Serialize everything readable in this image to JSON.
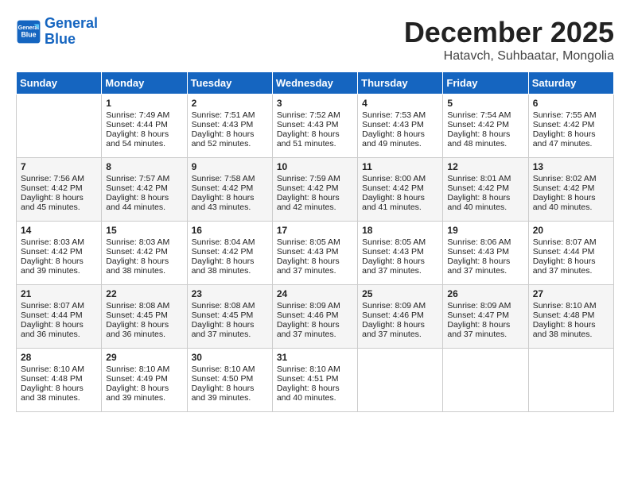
{
  "header": {
    "logo_line1": "General",
    "logo_line2": "Blue",
    "month": "December 2025",
    "location": "Hatavch, Suhbaatar, Mongolia"
  },
  "weekdays": [
    "Sunday",
    "Monday",
    "Tuesday",
    "Wednesday",
    "Thursday",
    "Friday",
    "Saturday"
  ],
  "weeks": [
    [
      {
        "day": "",
        "info": ""
      },
      {
        "day": "1",
        "info": "Sunrise: 7:49 AM\nSunset: 4:44 PM\nDaylight: 8 hours\nand 54 minutes."
      },
      {
        "day": "2",
        "info": "Sunrise: 7:51 AM\nSunset: 4:43 PM\nDaylight: 8 hours\nand 52 minutes."
      },
      {
        "day": "3",
        "info": "Sunrise: 7:52 AM\nSunset: 4:43 PM\nDaylight: 8 hours\nand 51 minutes."
      },
      {
        "day": "4",
        "info": "Sunrise: 7:53 AM\nSunset: 4:43 PM\nDaylight: 8 hours\nand 49 minutes."
      },
      {
        "day": "5",
        "info": "Sunrise: 7:54 AM\nSunset: 4:42 PM\nDaylight: 8 hours\nand 48 minutes."
      },
      {
        "day": "6",
        "info": "Sunrise: 7:55 AM\nSunset: 4:42 PM\nDaylight: 8 hours\nand 47 minutes."
      }
    ],
    [
      {
        "day": "7",
        "info": "Sunrise: 7:56 AM\nSunset: 4:42 PM\nDaylight: 8 hours\nand 45 minutes."
      },
      {
        "day": "8",
        "info": "Sunrise: 7:57 AM\nSunset: 4:42 PM\nDaylight: 8 hours\nand 44 minutes."
      },
      {
        "day": "9",
        "info": "Sunrise: 7:58 AM\nSunset: 4:42 PM\nDaylight: 8 hours\nand 43 minutes."
      },
      {
        "day": "10",
        "info": "Sunrise: 7:59 AM\nSunset: 4:42 PM\nDaylight: 8 hours\nand 42 minutes."
      },
      {
        "day": "11",
        "info": "Sunrise: 8:00 AM\nSunset: 4:42 PM\nDaylight: 8 hours\nand 41 minutes."
      },
      {
        "day": "12",
        "info": "Sunrise: 8:01 AM\nSunset: 4:42 PM\nDaylight: 8 hours\nand 40 minutes."
      },
      {
        "day": "13",
        "info": "Sunrise: 8:02 AM\nSunset: 4:42 PM\nDaylight: 8 hours\nand 40 minutes."
      }
    ],
    [
      {
        "day": "14",
        "info": "Sunrise: 8:03 AM\nSunset: 4:42 PM\nDaylight: 8 hours\nand 39 minutes."
      },
      {
        "day": "15",
        "info": "Sunrise: 8:03 AM\nSunset: 4:42 PM\nDaylight: 8 hours\nand 38 minutes."
      },
      {
        "day": "16",
        "info": "Sunrise: 8:04 AM\nSunset: 4:42 PM\nDaylight: 8 hours\nand 38 minutes."
      },
      {
        "day": "17",
        "info": "Sunrise: 8:05 AM\nSunset: 4:43 PM\nDaylight: 8 hours\nand 37 minutes."
      },
      {
        "day": "18",
        "info": "Sunrise: 8:05 AM\nSunset: 4:43 PM\nDaylight: 8 hours\nand 37 minutes."
      },
      {
        "day": "19",
        "info": "Sunrise: 8:06 AM\nSunset: 4:43 PM\nDaylight: 8 hours\nand 37 minutes."
      },
      {
        "day": "20",
        "info": "Sunrise: 8:07 AM\nSunset: 4:44 PM\nDaylight: 8 hours\nand 37 minutes."
      }
    ],
    [
      {
        "day": "21",
        "info": "Sunrise: 8:07 AM\nSunset: 4:44 PM\nDaylight: 8 hours\nand 36 minutes."
      },
      {
        "day": "22",
        "info": "Sunrise: 8:08 AM\nSunset: 4:45 PM\nDaylight: 8 hours\nand 36 minutes."
      },
      {
        "day": "23",
        "info": "Sunrise: 8:08 AM\nSunset: 4:45 PM\nDaylight: 8 hours\nand 37 minutes."
      },
      {
        "day": "24",
        "info": "Sunrise: 8:09 AM\nSunset: 4:46 PM\nDaylight: 8 hours\nand 37 minutes."
      },
      {
        "day": "25",
        "info": "Sunrise: 8:09 AM\nSunset: 4:46 PM\nDaylight: 8 hours\nand 37 minutes."
      },
      {
        "day": "26",
        "info": "Sunrise: 8:09 AM\nSunset: 4:47 PM\nDaylight: 8 hours\nand 37 minutes."
      },
      {
        "day": "27",
        "info": "Sunrise: 8:10 AM\nSunset: 4:48 PM\nDaylight: 8 hours\nand 38 minutes."
      }
    ],
    [
      {
        "day": "28",
        "info": "Sunrise: 8:10 AM\nSunset: 4:48 PM\nDaylight: 8 hours\nand 38 minutes."
      },
      {
        "day": "29",
        "info": "Sunrise: 8:10 AM\nSunset: 4:49 PM\nDaylight: 8 hours\nand 39 minutes."
      },
      {
        "day": "30",
        "info": "Sunrise: 8:10 AM\nSunset: 4:50 PM\nDaylight: 8 hours\nand 39 minutes."
      },
      {
        "day": "31",
        "info": "Sunrise: 8:10 AM\nSunset: 4:51 PM\nDaylight: 8 hours\nand 40 minutes."
      },
      {
        "day": "",
        "info": ""
      },
      {
        "day": "",
        "info": ""
      },
      {
        "day": "",
        "info": ""
      }
    ]
  ]
}
